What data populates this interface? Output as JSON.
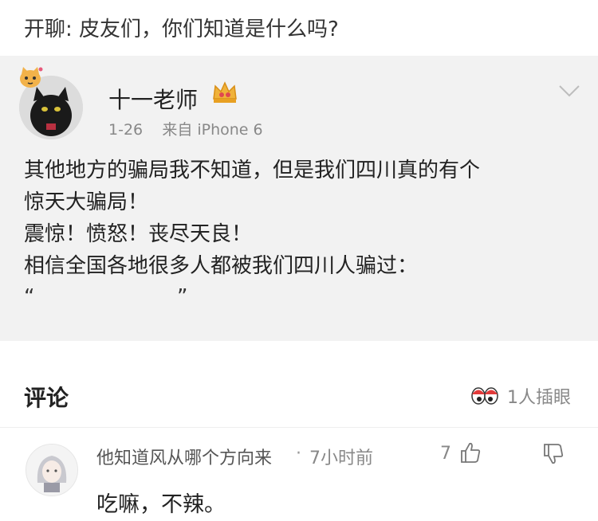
{
  "header": {
    "title": "开聊: 皮友们，你们知道是什么吗?"
  },
  "post": {
    "author": "十一老师",
    "date": "1-26",
    "source": "来自 iPhone 6",
    "lines": [
      "其他地方的骗局我不知道，但是我们四川真的有个",
      "惊天大骗局！",
      "震惊！愤怒！丧尽天良！",
      "相信全国各地很多人都被我们四川人骗过："
    ],
    "quote_open": "“",
    "quote_close": "”",
    "icons": {
      "avatar_badge": "cat-face-icon",
      "vip": "crown-icon",
      "more": "chevron-down-icon"
    }
  },
  "comments": {
    "title": "评论",
    "peek_count": "1人插眼",
    "peek_icon": "eyes-icon",
    "items": [
      {
        "author": "他知道风从哪个方向来",
        "separator": "·",
        "time": "7小时前",
        "likes": "7",
        "text": "吃嘛，不辣。",
        "icons": {
          "like": "thumbs-up-icon",
          "dislike": "thumbs-down-icon"
        }
      }
    ]
  },
  "colors": {
    "card_bg": "#f2f2f2",
    "accent_gold": "#e8a93a",
    "muted": "#888888"
  }
}
